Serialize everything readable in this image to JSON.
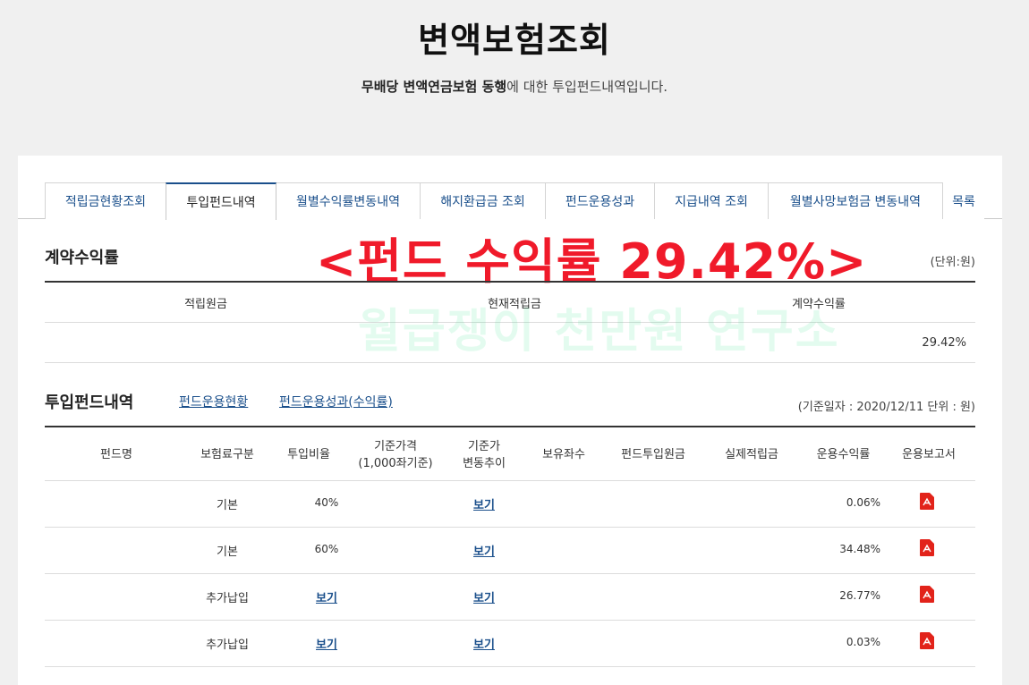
{
  "header": {
    "title": "변액보험조회",
    "subtitle_bold": "무배당 변액연금보험 동행",
    "subtitle_rest": "에 대한 투입펀드내역입니다."
  },
  "tabs": [
    {
      "label": "적립금현황조회",
      "active": false
    },
    {
      "label": "투입펀드내역",
      "active": true
    },
    {
      "label": "월별수익률변동내역",
      "active": false
    },
    {
      "label": "해지환급금 조회",
      "active": false
    },
    {
      "label": "펀드운용성과",
      "active": false
    },
    {
      "label": "지급내역 조회",
      "active": false
    },
    {
      "label": "월별사망보험금 변동내역",
      "active": false
    },
    {
      "label": "목록",
      "active": false
    }
  ],
  "overlay": "<펀드 수익률 29.42%>",
  "watermark": "월급쟁이 천만원 연구소",
  "contract": {
    "title": "계약수익률",
    "unit": "(단위:원)",
    "headers": [
      "적립원금",
      "현재적립금",
      "계약수익률"
    ],
    "values": [
      "",
      "",
      "29.42%"
    ]
  },
  "funds": {
    "title": "투입펀드내역",
    "link_status": "펀드운용현황",
    "link_performance": "펀드운용성과(수익률)",
    "date_info": "(기준일자 : 2020/12/11 단위 : 원)",
    "headers": {
      "fund_name": "펀드명",
      "premium_type": "보험료구분",
      "ratio": "투입비율",
      "base_price_1": "기준가격",
      "base_price_2": "(1,000좌기준)",
      "trend_1": "기준가",
      "trend_2": "변동추이",
      "units": "보유좌수",
      "principal": "펀드투입원금",
      "actual": "실제적립금",
      "return": "운용수익률",
      "report": "운용보고서"
    },
    "rows": [
      {
        "fund_name": "",
        "premium_type": "기본",
        "ratio": "40%",
        "trend": "보기",
        "return": "0.06%"
      },
      {
        "fund_name": "",
        "premium_type": "기본",
        "ratio": "60%",
        "trend": "보기",
        "return": "34.48%"
      },
      {
        "fund_name": "",
        "premium_type": "추가납입",
        "ratio": "보기",
        "trend": "보기",
        "return": "26.77%"
      },
      {
        "fund_name": "",
        "premium_type": "추가납입",
        "ratio": "보기",
        "trend": "보기",
        "return": "0.03%"
      }
    ]
  },
  "colors": {
    "accent": "#1a4f8b",
    "overlay": "#f01a2a",
    "pdf": "#e2231a"
  }
}
